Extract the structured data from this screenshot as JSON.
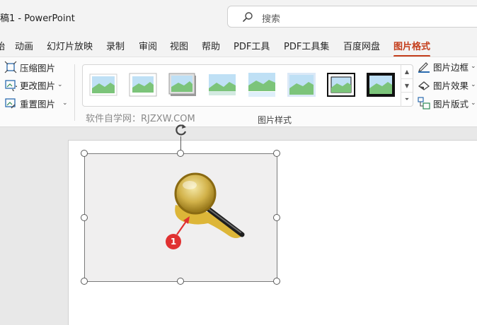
{
  "titlebar": {
    "doc_title": "稿1  -  PowerPoint",
    "search_placeholder": "搜索"
  },
  "tabs": [
    {
      "label": "始",
      "active": false
    },
    {
      "label": "动画",
      "active": false
    },
    {
      "label": "幻灯片放映",
      "active": false
    },
    {
      "label": "录制",
      "active": false
    },
    {
      "label": "审阅",
      "active": false
    },
    {
      "label": "视图",
      "active": false
    },
    {
      "label": "帮助",
      "active": false
    },
    {
      "label": "PDF工具",
      "active": false
    },
    {
      "label": "PDF工具集",
      "active": false
    },
    {
      "label": "百度网盘",
      "active": false
    },
    {
      "label": "图片格式",
      "active": true
    }
  ],
  "ribbon": {
    "adjust": {
      "compress": "压缩图片",
      "change": "更改图片",
      "reset": "重置图片"
    },
    "styles_group_label": "图片样式",
    "watermark": "软件自学网：RJZXW.COM",
    "right": {
      "border": "图片边框",
      "effects": "图片效果",
      "layout": "图片版式"
    }
  },
  "annotation": {
    "marker": "1"
  },
  "colors": {
    "accent": "#c43e1c",
    "marker": "#e03131"
  }
}
